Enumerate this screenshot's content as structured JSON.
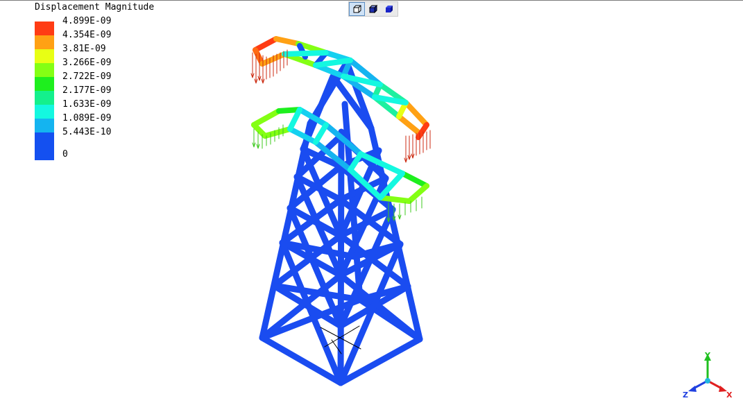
{
  "legend": {
    "title": "Displacement Magnitude",
    "entries": [
      {
        "label": "4.899E-09",
        "color": "#ff3c14"
      },
      {
        "label": "4.354E-09",
        "color": "#ffa114"
      },
      {
        "label": "3.81E-09",
        "color": "#e8ff14"
      },
      {
        "label": "3.266E-09",
        "color": "#84ff14"
      },
      {
        "label": "2.722E-09",
        "color": "#1eef1e"
      },
      {
        "label": "2.177E-09",
        "color": "#14f08c"
      },
      {
        "label": "1.633E-09",
        "color": "#14f8e0"
      },
      {
        "label": "1.089E-09",
        "color": "#14b4f0"
      },
      {
        "label": "5.443E-10",
        "color": "#1450f0"
      },
      {
        "label": "0",
        "color": "#1450f0"
      }
    ]
  },
  "toolbar": {
    "buttons": [
      {
        "icon": "wireframe-cube-icon",
        "active": true
      },
      {
        "icon": "shaded-cube-icon",
        "active": false
      },
      {
        "icon": "solid-cube-icon",
        "active": false
      }
    ]
  },
  "axes": {
    "x": "X",
    "y": "Y",
    "z": "Z"
  },
  "colors": {
    "structure": "#1a4cf0",
    "load_arrows": "#cc2a10",
    "x_axis": "#e02020",
    "y_axis": "#20c020",
    "z_axis": "#2040e0"
  }
}
